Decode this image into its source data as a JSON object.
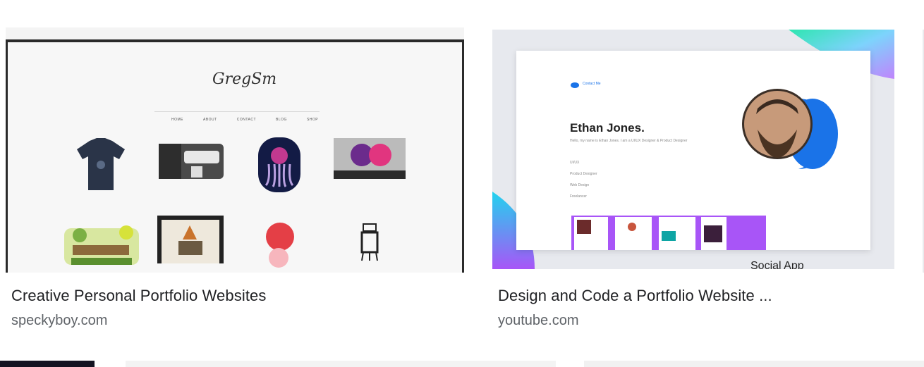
{
  "results": [
    {
      "title": "Creative Personal Portfolio Websites",
      "source": "speckyboy.com",
      "thumb": {
        "logo_text": "GregSm",
        "nav": [
          "HOME",
          "ABOUT",
          "CONTACT",
          "BLOG",
          "SHOP"
        ]
      }
    },
    {
      "title": "Design and Code a Portfolio Website ...",
      "source": "youtube.com",
      "thumb": {
        "brand": "Contact Me",
        "name": "Ethan Jones.",
        "intro": "Hello, my name is Ethan Jones. I am a UI/UX Designer & Product Designer",
        "skills": [
          "UI/UX",
          "Product Designer",
          "Web Design",
          "Freelancer"
        ],
        "section": "Social App"
      }
    }
  ],
  "colors": {
    "title": "#202124",
    "source": "#5f6368",
    "accent_blue": "#1a73e8"
  }
}
